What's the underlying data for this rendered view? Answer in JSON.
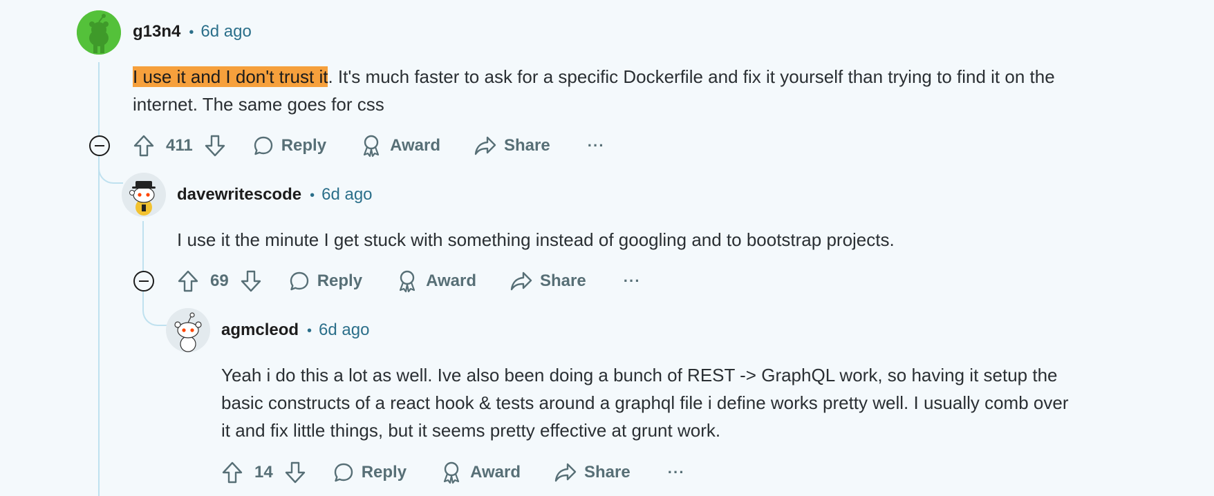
{
  "comments": [
    {
      "author": "g13n4",
      "time": "6d ago",
      "highlight": "I use it and I don't trust it",
      "body": ". It's much faster to ask for a specific Dockerfile and fix it yourself than trying to find it on the internet. The same goes for css",
      "votes": "411",
      "reply_label": "Reply",
      "award_label": "Award",
      "share_label": "Share",
      "more_label": "···"
    },
    {
      "author": "davewritescode",
      "time": "6d ago",
      "body": "I use it the minute I get stuck with something instead of googling and to bootstrap projects.",
      "votes": "69",
      "reply_label": "Reply",
      "award_label": "Award",
      "share_label": "Share",
      "more_label": "···"
    },
    {
      "author": "agmcleod",
      "time": "6d ago",
      "body": "Yeah i do this a lot as well. Ive also been doing a bunch of REST -> GraphQL work, so having it setup the basic constructs of a react hook & tests around a graphql file i define works pretty well. I usually comb over it and fix little things, but it seems pretty effective at grunt work.",
      "votes": "14",
      "reply_label": "Reply",
      "award_label": "Award",
      "share_label": "Share",
      "more_label": "···"
    }
  ],
  "separator": "•",
  "colors": {
    "background": "#f4f9fc",
    "highlight": "#f6a03c",
    "thread_line": "#bfe1ef",
    "timestamp": "#2b6f8a"
  }
}
